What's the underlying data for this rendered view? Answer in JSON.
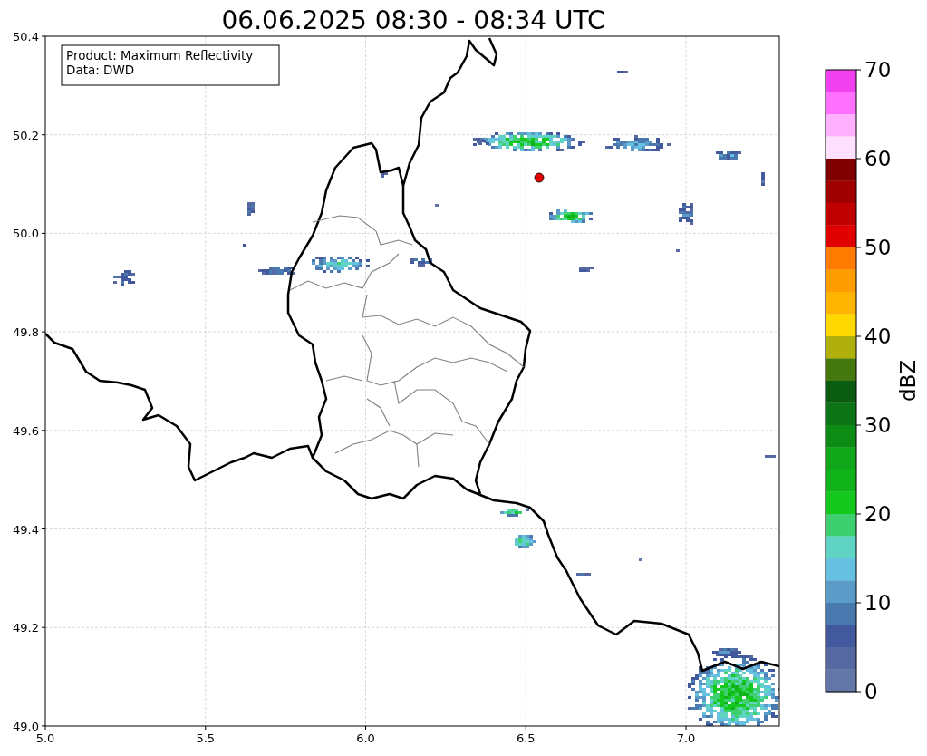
{
  "title": "06.06.2025 08:30 - 08:34 UTC",
  "map": {
    "xticks": [
      "5.0",
      "5.5",
      "6.0",
      "6.5",
      "7.0"
    ],
    "yticks": [
      "50.4",
      "50.2",
      "50.0",
      "49.8",
      "49.6",
      "49.4",
      "49.2",
      "49.0"
    ],
    "info_box": [
      "Product: Maximum Reflectivity",
      "Data: DWD"
    ]
  },
  "colorbar": {
    "label": "dBZ",
    "ticks": [
      "70",
      "60",
      "50",
      "40",
      "30",
      "20",
      "10",
      "0"
    ],
    "levels": [
      {
        "color": "#f040f0"
      },
      {
        "color": "#ff70ff"
      },
      {
        "color": "#ffb0ff"
      },
      {
        "color": "#ffe0ff"
      },
      {
        "color": "#800000"
      },
      {
        "color": "#a00000"
      },
      {
        "color": "#c00000"
      },
      {
        "color": "#e00000"
      },
      {
        "color": "#ff7c00"
      },
      {
        "color": "#ff9c00"
      },
      {
        "color": "#ffb400"
      },
      {
        "color": "#ffd800"
      },
      {
        "color": "#b0b00c"
      },
      {
        "color": "#467810"
      },
      {
        "color": "#0a5c10"
      },
      {
        "color": "#0c7414"
      },
      {
        "color": "#0c8c14"
      },
      {
        "color": "#10a81a"
      },
      {
        "color": "#10b41a"
      },
      {
        "color": "#14c81e"
      },
      {
        "color": "#3ed070"
      },
      {
        "color": "#60d4c4"
      },
      {
        "color": "#66c0e0"
      },
      {
        "color": "#5a9bc8"
      },
      {
        "color": "#4a79b0"
      },
      {
        "color": "#43599e"
      },
      {
        "color": "#5569a0"
      },
      {
        "color": "#6276a8"
      }
    ]
  }
}
